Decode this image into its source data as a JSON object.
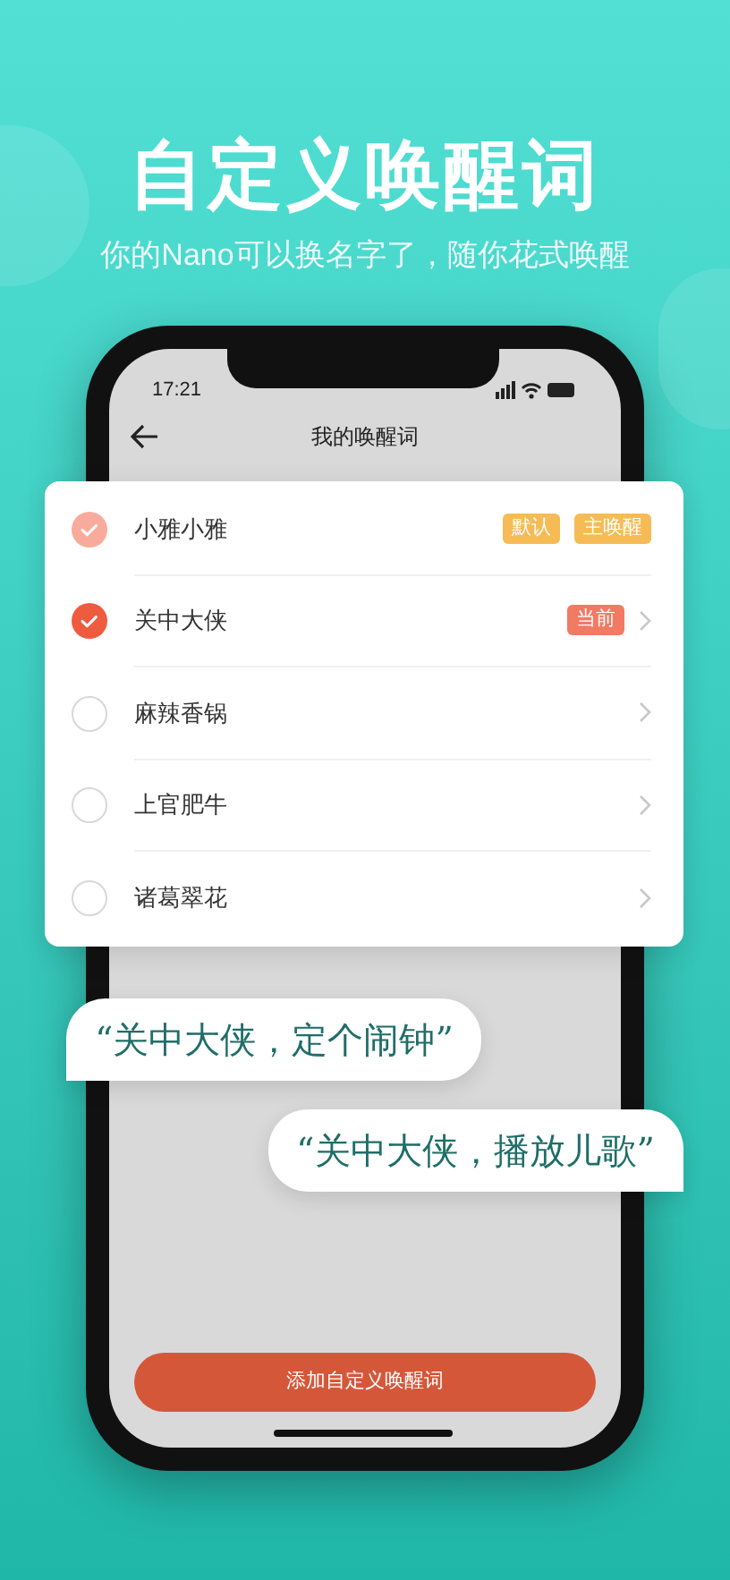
{
  "header": {
    "title": "自定义唤醒词",
    "subtitle": "你的Nano可以换名字了，随你花式唤醒"
  },
  "phone": {
    "status_time": "17:21",
    "nav_title": "我的唤醒词",
    "add_button": "添加自定义唤醒词"
  },
  "wake_words": [
    {
      "name": "小雅小雅",
      "checked": true,
      "disabled": true,
      "tags": [
        {
          "label": "默认",
          "color": "#f7bb55"
        },
        {
          "label": "主唤醒",
          "color": "#f7bb55"
        }
      ]
    },
    {
      "name": "关中大侠",
      "checked": true,
      "disabled": false,
      "tags": [
        {
          "label": "当前",
          "color": "#f27a63"
        }
      ]
    },
    {
      "name": "麻辣香锅",
      "checked": false,
      "disabled": false
    },
    {
      "name": "上官肥牛",
      "checked": false,
      "disabled": false
    },
    {
      "name": "诸葛翠花",
      "checked": false,
      "disabled": false
    }
  ],
  "bubbles": [
    {
      "text": "“关中大侠，定个闹钟”",
      "kind": "left"
    },
    {
      "text": "“关中大侠，播放儿歌”",
      "kind": "right"
    }
  ]
}
